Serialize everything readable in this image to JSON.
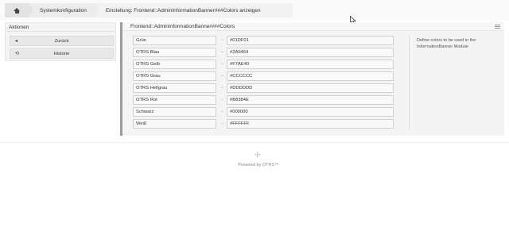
{
  "breadcrumb": {
    "home_icon": "home-icon",
    "items": [
      "Systemkonfiguration",
      "Einstellung: Frontend::AdminInformationBanner###Colors anzeigen"
    ]
  },
  "sidebar": {
    "title": "Aktionen",
    "buttons": [
      {
        "label": "Zurück",
        "icon": "caret-left-icon"
      },
      {
        "label": "Historie",
        "icon": "history-icon"
      }
    ]
  },
  "setting": {
    "title": "Frontend::AdminInformationBanner###Colors",
    "rows": [
      {
        "key": "Grün",
        "value": "#01DF01"
      },
      {
        "key": "OTRS Blau",
        "value": "#2A5464"
      },
      {
        "key": "OTRS Gelb",
        "value": "#F7AE40"
      },
      {
        "key": "OTRS Grau",
        "value": "#CCCCCC"
      },
      {
        "key": "OTRS Hellgrau",
        "value": "#DDDDDD"
      },
      {
        "key": "OTRS Rot",
        "value": "#B8384E"
      },
      {
        "key": "Schwarz",
        "value": "#000000"
      },
      {
        "key": "Weiß",
        "value": "#FFFFFF"
      }
    ],
    "description": "Define colors to be used in the InformationBanner Module"
  },
  "footer": {
    "powered_by": "Powered by OTRS™"
  }
}
